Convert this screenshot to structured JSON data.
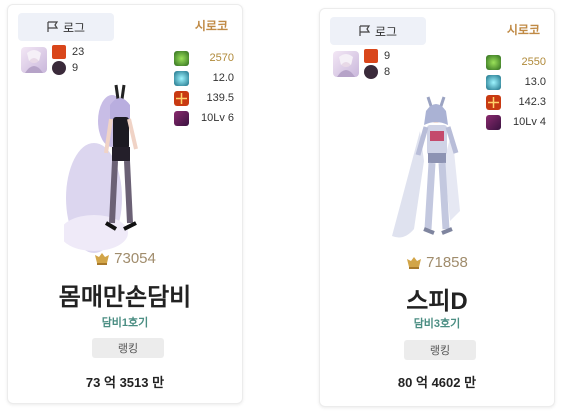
{
  "cards": [
    {
      "adventure_label": "로그",
      "server": "시로코",
      "small_stats": [
        "23",
        "9"
      ],
      "stats": [
        "2570",
        "12.0",
        "139.5",
        "10Lv 6"
      ],
      "score": "73054",
      "name": "몸매만손담비",
      "guild": "담비1호기",
      "rank_label": "랭킹",
      "power": "73 억 3513 만"
    },
    {
      "adventure_label": "로그",
      "server": "시로코",
      "small_stats": [
        "9",
        "8"
      ],
      "stats": [
        "2550",
        "13.0",
        "142.3",
        "10Lv 4"
      ],
      "score": "71858",
      "name": "스피D",
      "guild": "담비3호기",
      "rank_label": "랭킹",
      "power": "80 억 4602 만"
    }
  ],
  "icons": {
    "adventure": "flag-icon",
    "small_stat_1": "red-crystal-icon",
    "small_stat_2": "dark-orb-icon",
    "stat_1": "green-gem-icon",
    "stat_2": "cyan-burst-icon",
    "stat_3": "red-cross-icon",
    "stat_4": "purple-level-icon",
    "score": "gold-crest-icon"
  },
  "colors": {
    "server": "#c08a45",
    "guild": "#4b8e83",
    "score": "#a08c6c",
    "badge_bg": "#eef1f8"
  }
}
